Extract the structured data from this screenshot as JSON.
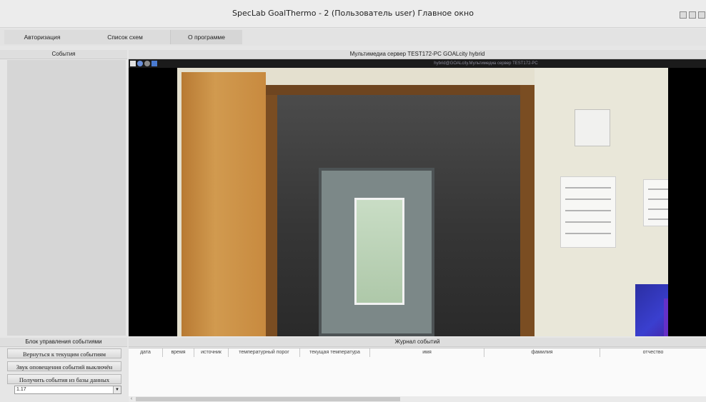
{
  "window": {
    "title": "SpecLab GoalThermo - 2  (Пользователь user) Главное окно",
    "buttons": [
      "minimize-icon",
      "maximize-icon",
      "close-icon"
    ]
  },
  "menu": {
    "items": [
      "Авторизация",
      "Список схем",
      "О программе"
    ]
  },
  "events_panel": {
    "title": "События"
  },
  "video": {
    "title": "Мультимедиа сервер TEST172-PC GOALcity hybrid",
    "stream_label": "hybrid@GOALcity.Мультимедиа сервер TEST172-PC",
    "toolbar_icons": [
      "zoom-icon",
      "search-icon",
      "settings-icon",
      "save-icon"
    ],
    "toolbar_colors": [
      "#e0e0e0",
      "#6a8fd8",
      "#8c8c8c",
      "#4a7bd0"
    ]
  },
  "control_block": {
    "title": "Блок управления событиями",
    "buttons": [
      "Вернуться к текущим событиям",
      "Звук оповещения событий выключён",
      "Получить события из базы данных"
    ],
    "select_value": "1.17"
  },
  "journal": {
    "title": "Журнал событий",
    "columns": [
      "дата",
      "время",
      "источник",
      "температурный порог",
      "текущая температура",
      "имя",
      "фамилия",
      "отчество"
    ],
    "rows": []
  }
}
